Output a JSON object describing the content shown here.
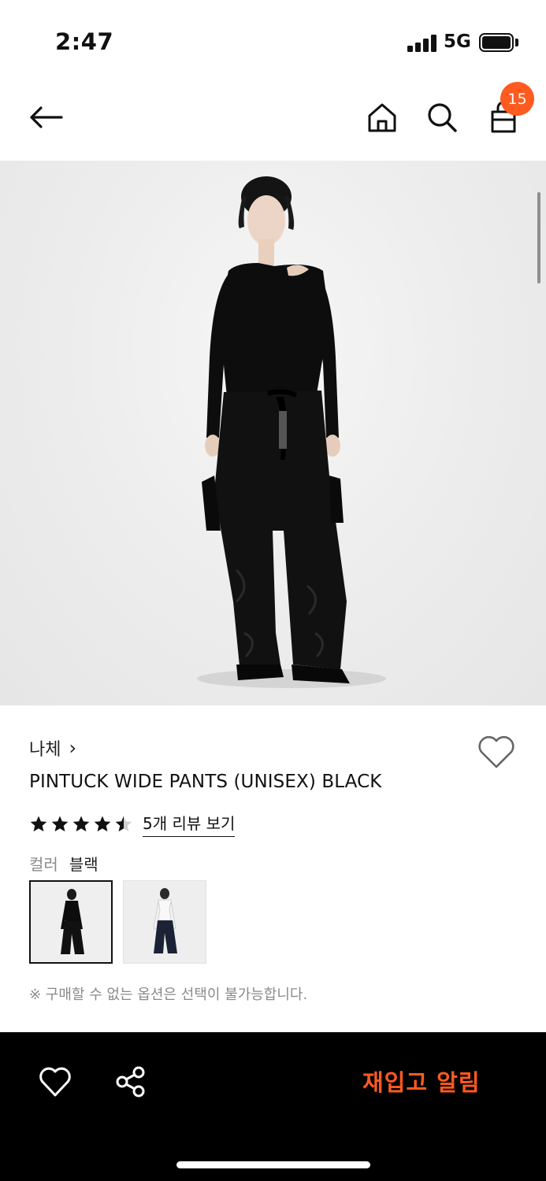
{
  "status_bar": {
    "time": "2:47",
    "network": "5G",
    "signal_icon": "signal-bars-icon",
    "battery_icon": "battery-icon"
  },
  "nav": {
    "back_icon": "arrow-left-icon",
    "home_icon": "home-icon",
    "search_icon": "search-icon",
    "cart_icon": "shopping-bag-icon",
    "cart_count": "15",
    "accent_color": "#ff5a1f"
  },
  "product": {
    "brand": "나체",
    "brand_chevron": "›",
    "title": "PINTUCK WIDE PANTS (UNISEX) BLACK",
    "rating": 4.5,
    "rating_max": 5,
    "review_link": "5개 리뷰 보기",
    "color_label": "컬러",
    "color_value": "블랙",
    "swatches": [
      {
        "label": "black-outfit",
        "selected": true
      },
      {
        "label": "white-top-navy-pants",
        "selected": false
      }
    ],
    "notice": "※ 구매할 수 없는 옵션은 선택이 불가능합니다."
  },
  "bottom_bar": {
    "heart_icon": "heart-outline-icon",
    "share_icon": "share-icon",
    "restock_button": "재입고 알림"
  }
}
